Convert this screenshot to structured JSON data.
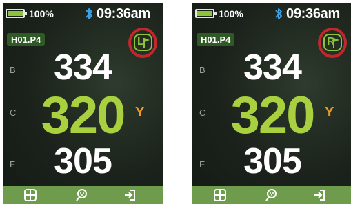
{
  "screens": [
    {
      "battery_pct": "100%",
      "time": "09:36am",
      "hole": "H01.P4",
      "pin_position": "L",
      "labels": {
        "back": "B",
        "center": "C",
        "front": "F"
      },
      "distances": {
        "back": "334",
        "center": "320",
        "front": "305"
      },
      "unit": "Y"
    },
    {
      "battery_pct": "100%",
      "time": "09:36am",
      "hole": "H01.P4",
      "pin_position": "R",
      "labels": {
        "back": "B",
        "center": "C",
        "front": "F"
      },
      "distances": {
        "back": "334",
        "center": "320",
        "front": "305"
      },
      "unit": "Y"
    }
  ],
  "icons": {
    "battery": "battery-icon",
    "bluetooth": "bluetooth-icon",
    "pin_flag": "flag-icon",
    "menu": "grid-icon",
    "ball": "golf-ball-icon",
    "exit": "exit-icon"
  },
  "colors": {
    "accent_green": "#a8d03f",
    "unit_orange": "#f09a2c",
    "highlight_ring": "#c0282d",
    "bottom_bar": "#6f9b4d"
  }
}
